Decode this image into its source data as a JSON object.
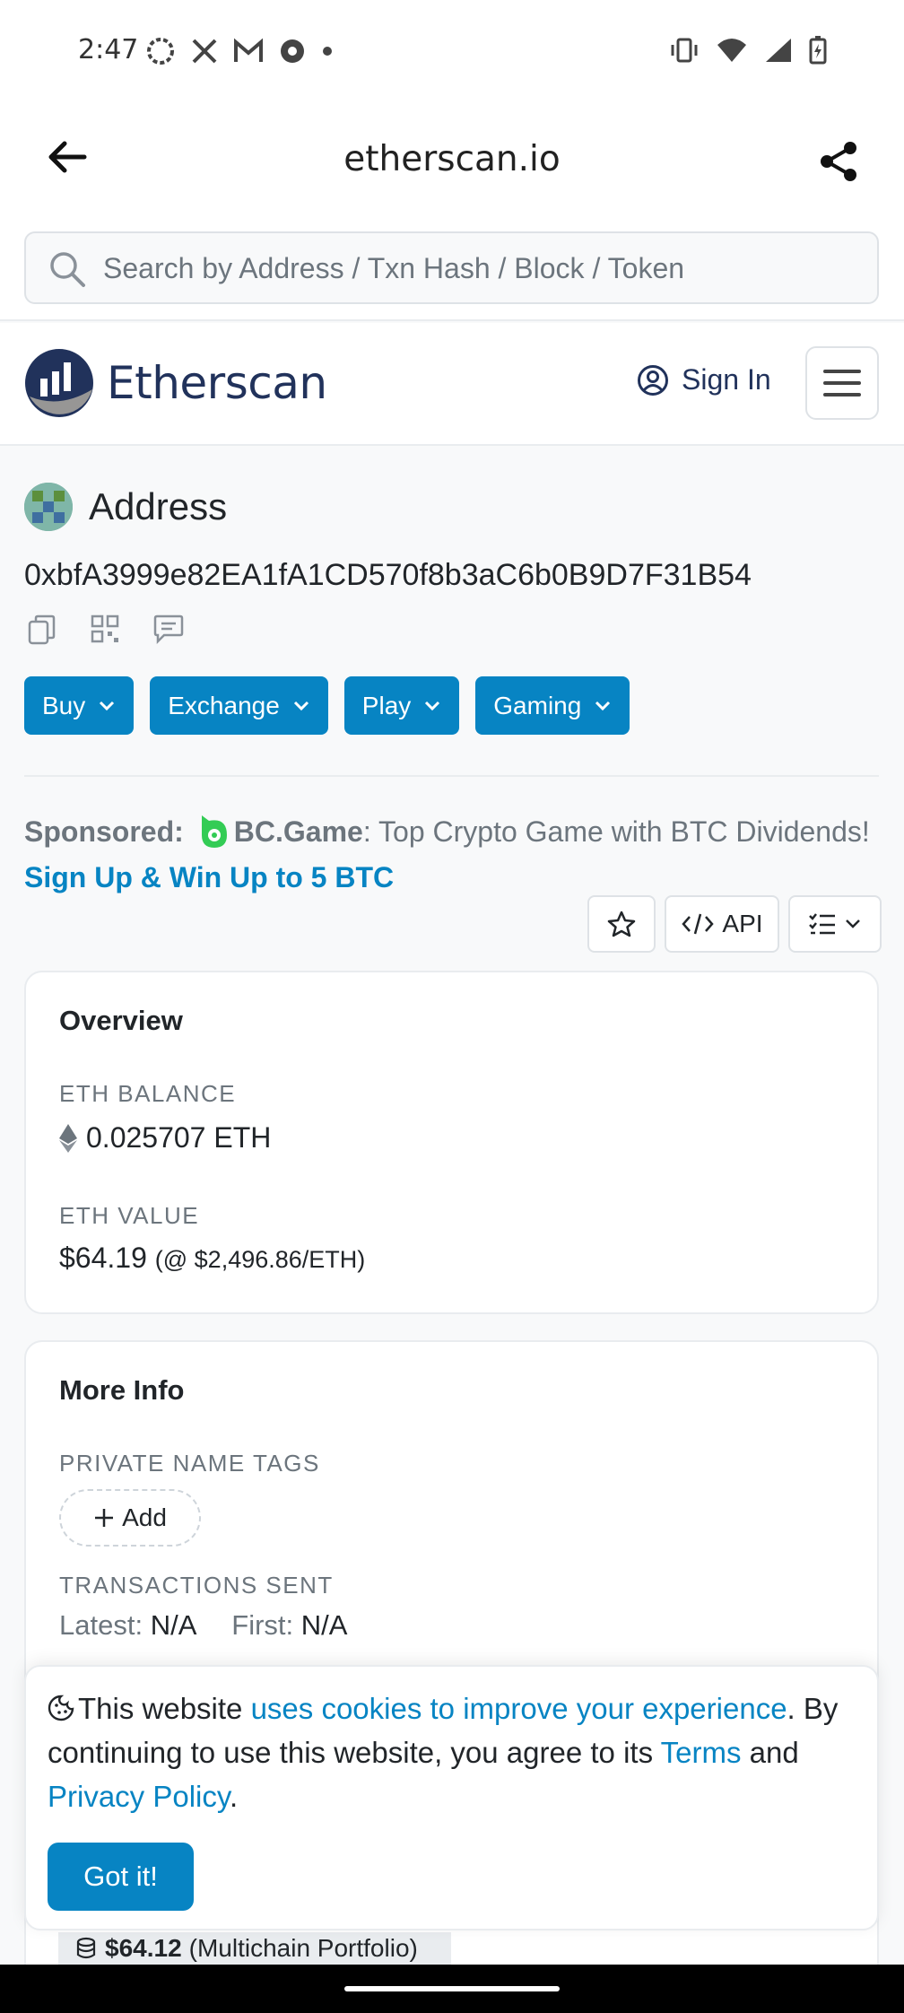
{
  "status_bar": {
    "time": "2:47"
  },
  "browser": {
    "url": "etherscan.io",
    "search_placeholder": "Search by Address / Txn Hash / Block / Token"
  },
  "header": {
    "logo_text": "Etherscan",
    "sign_in": "Sign In"
  },
  "address": {
    "title": "Address",
    "hash": "0xbfA3999e82EA1fA1CD570f8b3aC6b0B9D7F31B54"
  },
  "action_buttons": [
    "Buy",
    "Exchange",
    "Play",
    "Gaming"
  ],
  "sponsor": {
    "label": "Sponsored:",
    "brand": "BC.Game",
    "text": ": Top Crypto Game with BTC Dividends!",
    "cta": "Sign Up & Win Up to 5 BTC"
  },
  "toolbar": {
    "api_label": "API"
  },
  "overview": {
    "title": "Overview",
    "eth_balance_label": "ETH BALANCE",
    "eth_balance": "0.025707 ETH",
    "eth_value_label": "ETH VALUE",
    "eth_value": "$64.19",
    "eth_price": "(@ $2,496.86/ETH)"
  },
  "more_info": {
    "title": "More Info",
    "private_tags_label": "PRIVATE NAME TAGS",
    "add_label": "Add",
    "tx_sent_label": "TRANSACTIONS SENT",
    "latest_label": "Latest:",
    "latest_value": "N/A",
    "first_label": "First:",
    "first_value": "N/A"
  },
  "cookie_banner": {
    "text_1": "This website ",
    "link_1": "uses cookies to improve your experience",
    "text_2": ". By continuing to use this website, you agree to its ",
    "link_terms": "Terms",
    "text_3": " and ",
    "link_privacy": "Privacy Policy",
    "text_4": ".",
    "button": "Got it!"
  },
  "portfolio": {
    "amount": "$64.12",
    "label": "(Multichain Portfolio)"
  },
  "colors": {
    "primary": "#0784c3",
    "brand_dark": "#21325b",
    "muted": "#6c757d"
  }
}
